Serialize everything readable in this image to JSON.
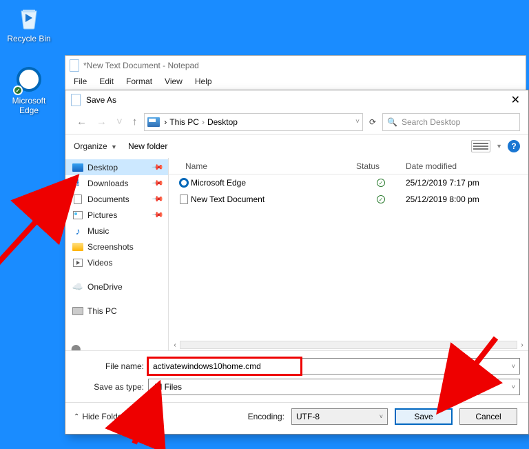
{
  "desktop": {
    "icons": [
      {
        "label": "Recycle Bin"
      },
      {
        "label": "Microsoft Edge"
      }
    ]
  },
  "notepad": {
    "title": "*New Text Document - Notepad",
    "menu": [
      "File",
      "Edit",
      "Format",
      "View",
      "Help"
    ]
  },
  "saveas": {
    "title": "Save As",
    "close": "✕",
    "breadcrumb": {
      "part1": "This PC",
      "part2": "Desktop"
    },
    "refresh_glyph": "⟳",
    "search_placeholder": "Search Desktop",
    "organize": "Organize",
    "new_folder": "New folder",
    "help_glyph": "?",
    "dropdown_glyph": "▼",
    "columns": {
      "name": "Name",
      "status": "Status",
      "date": "Date modified"
    },
    "sidebar": [
      {
        "label": "Desktop",
        "icon": "desktop",
        "pinned": true,
        "selected": true
      },
      {
        "label": "Downloads",
        "icon": "download",
        "pinned": true
      },
      {
        "label": "Documents",
        "icon": "document",
        "pinned": true
      },
      {
        "label": "Pictures",
        "icon": "picture",
        "pinned": true
      },
      {
        "label": "Music",
        "icon": "music"
      },
      {
        "label": "Screenshots",
        "icon": "folder"
      },
      {
        "label": "Videos",
        "icon": "video"
      },
      {
        "label": "OneDrive",
        "icon": "cloud",
        "group_gap": true
      },
      {
        "label": "This PC",
        "icon": "pc",
        "group_gap": true
      }
    ],
    "rows": [
      {
        "name": "Microsoft Edge",
        "status": "synced",
        "date": "25/12/2019 7:17 pm",
        "icon": "edge"
      },
      {
        "name": "New Text Document",
        "status": "synced",
        "date": "25/12/2019 8:00 pm",
        "icon": "txt"
      }
    ],
    "status_glyph": "✓",
    "filename_label": "File name:",
    "filename_value": "activatewindows10home.cmd",
    "type_label": "Save as type:",
    "type_value": "All Files",
    "hide_folders": "Hide Folders",
    "encoding_label": "Encoding:",
    "encoding_value": "UTF-8",
    "save_btn": "Save",
    "cancel_btn": "Cancel"
  },
  "nav_glyphs": {
    "back": "←",
    "forward": "→",
    "up": "↑",
    "dd_small": "˅",
    "sep": "›",
    "chev_up": "⌃",
    "pin": "📌",
    "search": "🔍",
    "cloud": "☁️",
    "music": "♪",
    "download": "⭳",
    "scroll_l": "‹",
    "scroll_r": "›"
  }
}
